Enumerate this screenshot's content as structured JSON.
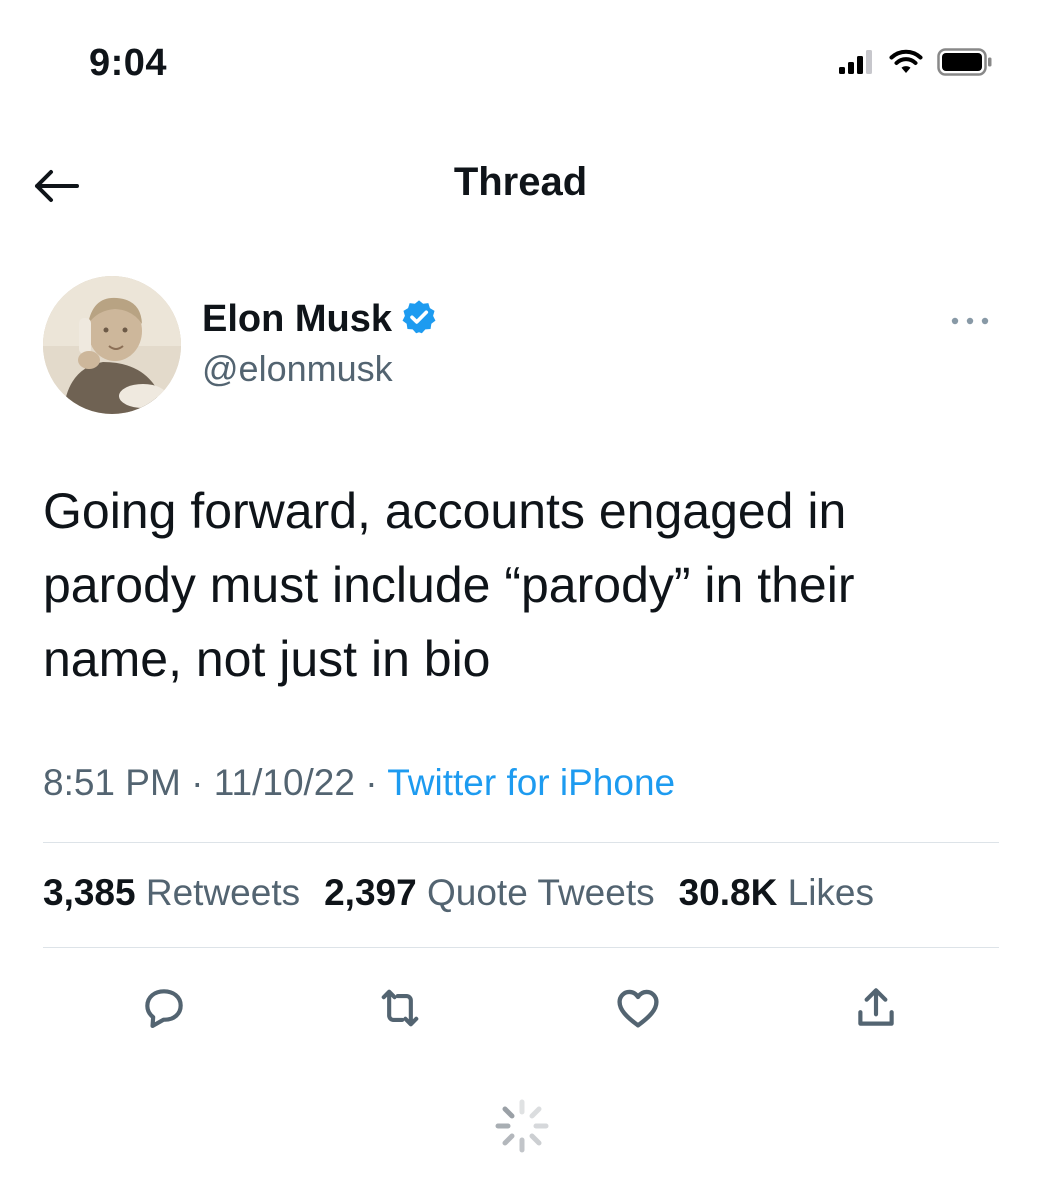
{
  "status_bar": {
    "time": "9:04",
    "icons": [
      "signal-icon",
      "wifi-icon",
      "battery-icon"
    ]
  },
  "header": {
    "title": "Thread",
    "back_icon": "arrow-left-icon"
  },
  "tweet": {
    "author_name": "Elon Musk",
    "author_handle": "@elonmusk",
    "verified": true,
    "text_lines": [
      "Going forward, accounts engaged in",
      "parody must include “parody” in their",
      "name, not just in bio"
    ],
    "time": "8:51 PM",
    "date": "11/10/22",
    "separator": "·",
    "source": "Twitter for iPhone",
    "stats": {
      "retweets_count": "3,385",
      "retweets_label": "Retweets",
      "quotes_count": "2,397",
      "quotes_label": "Quote Tweets",
      "likes_count": "30.8K",
      "likes_label": "Likes"
    }
  },
  "actions": [
    "reply-icon",
    "retweet-icon",
    "like-icon",
    "share-icon"
  ],
  "colors": {
    "accent": "#1d9bf0",
    "secondary_text": "#536471",
    "primary_text": "#0f1419",
    "divider": "#dde3e8"
  }
}
